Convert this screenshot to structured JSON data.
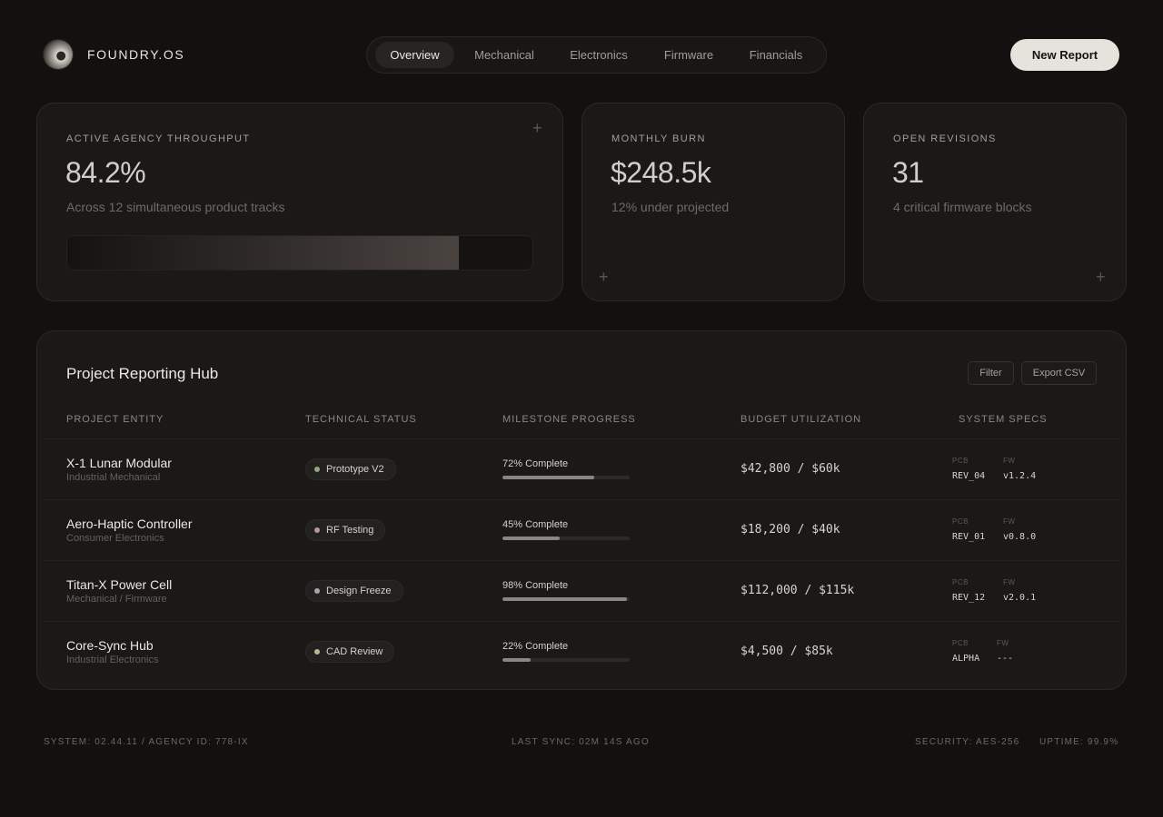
{
  "brand": {
    "name": "FOUNDRY.OS"
  },
  "nav": {
    "tabs": [
      {
        "label": "Overview",
        "active": true
      },
      {
        "label": "Mechanical"
      },
      {
        "label": "Electronics"
      },
      {
        "label": "Firmware"
      },
      {
        "label": "Financials"
      }
    ]
  },
  "header": {
    "new_report_label": "New Report"
  },
  "cards": [
    {
      "label": "ACTIVE AGENCY THROUGHPUT",
      "value": "84.2%",
      "sub": "Across 12 simultaneous product tracks",
      "progress": 0.842
    },
    {
      "label": "MONTHLY BURN",
      "value": "$248.5k",
      "sub": "12% under projected"
    },
    {
      "label": "OPEN REVISIONS",
      "value": "31",
      "sub": "4 critical firmware blocks"
    }
  ],
  "panel": {
    "title": "Project Reporting Hub",
    "filter_label": "Filter",
    "export_label": "Export CSV",
    "columns": [
      "PROJECT ENTITY",
      "TECHNICAL STATUS",
      "MILESTONE PROGRESS",
      "BUDGET UTILIZATION",
      "SYSTEM SPECS"
    ],
    "spec_keys": {
      "pcb": "PCB",
      "fw": "FW"
    },
    "rows": [
      {
        "name": "X-1 Lunar Modular",
        "category": "Industrial Mechanical",
        "status": "Prototype V2",
        "status_color": "#8fa77f",
        "progress_label": "72% Complete",
        "progress": 0.72,
        "budget": "$42,800 / $60k",
        "pcb": "REV_04",
        "fw": "v1.2.4"
      },
      {
        "name": "Aero-Haptic Controller",
        "category": "Consumer Electronics",
        "status": "RF Testing",
        "status_color": "#b09a9a",
        "progress_label": "45% Complete",
        "progress": 0.45,
        "budget": "$18,200 / $40k",
        "pcb": "REV_01",
        "fw": "v0.8.0"
      },
      {
        "name": "Titan-X Power Cell",
        "category": "Mechanical / Firmware",
        "status": "Design Freeze",
        "status_color": "#a5a3ad",
        "progress_label": "98% Complete",
        "progress": 0.98,
        "budget": "$112,000 / $115k",
        "pcb": "REV_12",
        "fw": "v2.0.1"
      },
      {
        "name": "Core-Sync Hub",
        "category": "Industrial Electronics",
        "status": "CAD Review",
        "status_color": "#b8b894",
        "progress_label": "22% Complete",
        "progress": 0.22,
        "budget": "$4,500 / $85k",
        "pcb": "ALPHA",
        "fw": "---"
      }
    ]
  },
  "footer": {
    "system": "SYSTEM: 02.44.11 / AGENCY ID: 778-IX",
    "sync": "LAST SYNC: 02M 14S AGO",
    "security": "SECURITY: AES-256",
    "uptime": "UPTIME: 99.9%"
  }
}
